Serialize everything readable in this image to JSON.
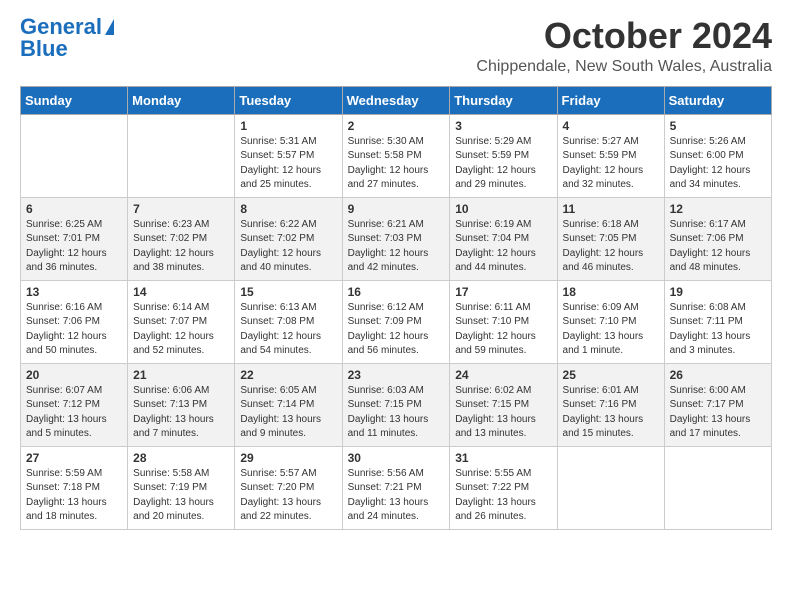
{
  "logo": {
    "general": "General",
    "blue": "Blue"
  },
  "header": {
    "month": "October 2024",
    "location": "Chippendale, New South Wales, Australia"
  },
  "weekdays": [
    "Sunday",
    "Monday",
    "Tuesday",
    "Wednesday",
    "Thursday",
    "Friday",
    "Saturday"
  ],
  "weeks": [
    [
      {
        "day": "",
        "info": ""
      },
      {
        "day": "",
        "info": ""
      },
      {
        "day": "1",
        "info": "Sunrise: 5:31 AM\nSunset: 5:57 PM\nDaylight: 12 hours\nand 25 minutes."
      },
      {
        "day": "2",
        "info": "Sunrise: 5:30 AM\nSunset: 5:58 PM\nDaylight: 12 hours\nand 27 minutes."
      },
      {
        "day": "3",
        "info": "Sunrise: 5:29 AM\nSunset: 5:59 PM\nDaylight: 12 hours\nand 29 minutes."
      },
      {
        "day": "4",
        "info": "Sunrise: 5:27 AM\nSunset: 5:59 PM\nDaylight: 12 hours\nand 32 minutes."
      },
      {
        "day": "5",
        "info": "Sunrise: 5:26 AM\nSunset: 6:00 PM\nDaylight: 12 hours\nand 34 minutes."
      }
    ],
    [
      {
        "day": "6",
        "info": "Sunrise: 6:25 AM\nSunset: 7:01 PM\nDaylight: 12 hours\nand 36 minutes."
      },
      {
        "day": "7",
        "info": "Sunrise: 6:23 AM\nSunset: 7:02 PM\nDaylight: 12 hours\nand 38 minutes."
      },
      {
        "day": "8",
        "info": "Sunrise: 6:22 AM\nSunset: 7:02 PM\nDaylight: 12 hours\nand 40 minutes."
      },
      {
        "day": "9",
        "info": "Sunrise: 6:21 AM\nSunset: 7:03 PM\nDaylight: 12 hours\nand 42 minutes."
      },
      {
        "day": "10",
        "info": "Sunrise: 6:19 AM\nSunset: 7:04 PM\nDaylight: 12 hours\nand 44 minutes."
      },
      {
        "day": "11",
        "info": "Sunrise: 6:18 AM\nSunset: 7:05 PM\nDaylight: 12 hours\nand 46 minutes."
      },
      {
        "day": "12",
        "info": "Sunrise: 6:17 AM\nSunset: 7:06 PM\nDaylight: 12 hours\nand 48 minutes."
      }
    ],
    [
      {
        "day": "13",
        "info": "Sunrise: 6:16 AM\nSunset: 7:06 PM\nDaylight: 12 hours\nand 50 minutes."
      },
      {
        "day": "14",
        "info": "Sunrise: 6:14 AM\nSunset: 7:07 PM\nDaylight: 12 hours\nand 52 minutes."
      },
      {
        "day": "15",
        "info": "Sunrise: 6:13 AM\nSunset: 7:08 PM\nDaylight: 12 hours\nand 54 minutes."
      },
      {
        "day": "16",
        "info": "Sunrise: 6:12 AM\nSunset: 7:09 PM\nDaylight: 12 hours\nand 56 minutes."
      },
      {
        "day": "17",
        "info": "Sunrise: 6:11 AM\nSunset: 7:10 PM\nDaylight: 12 hours\nand 59 minutes."
      },
      {
        "day": "18",
        "info": "Sunrise: 6:09 AM\nSunset: 7:10 PM\nDaylight: 13 hours\nand 1 minute."
      },
      {
        "day": "19",
        "info": "Sunrise: 6:08 AM\nSunset: 7:11 PM\nDaylight: 13 hours\nand 3 minutes."
      }
    ],
    [
      {
        "day": "20",
        "info": "Sunrise: 6:07 AM\nSunset: 7:12 PM\nDaylight: 13 hours\nand 5 minutes."
      },
      {
        "day": "21",
        "info": "Sunrise: 6:06 AM\nSunset: 7:13 PM\nDaylight: 13 hours\nand 7 minutes."
      },
      {
        "day": "22",
        "info": "Sunrise: 6:05 AM\nSunset: 7:14 PM\nDaylight: 13 hours\nand 9 minutes."
      },
      {
        "day": "23",
        "info": "Sunrise: 6:03 AM\nSunset: 7:15 PM\nDaylight: 13 hours\nand 11 minutes."
      },
      {
        "day": "24",
        "info": "Sunrise: 6:02 AM\nSunset: 7:15 PM\nDaylight: 13 hours\nand 13 minutes."
      },
      {
        "day": "25",
        "info": "Sunrise: 6:01 AM\nSunset: 7:16 PM\nDaylight: 13 hours\nand 15 minutes."
      },
      {
        "day": "26",
        "info": "Sunrise: 6:00 AM\nSunset: 7:17 PM\nDaylight: 13 hours\nand 17 minutes."
      }
    ],
    [
      {
        "day": "27",
        "info": "Sunrise: 5:59 AM\nSunset: 7:18 PM\nDaylight: 13 hours\nand 18 minutes."
      },
      {
        "day": "28",
        "info": "Sunrise: 5:58 AM\nSunset: 7:19 PM\nDaylight: 13 hours\nand 20 minutes."
      },
      {
        "day": "29",
        "info": "Sunrise: 5:57 AM\nSunset: 7:20 PM\nDaylight: 13 hours\nand 22 minutes."
      },
      {
        "day": "30",
        "info": "Sunrise: 5:56 AM\nSunset: 7:21 PM\nDaylight: 13 hours\nand 24 minutes."
      },
      {
        "day": "31",
        "info": "Sunrise: 5:55 AM\nSunset: 7:22 PM\nDaylight: 13 hours\nand 26 minutes."
      },
      {
        "day": "",
        "info": ""
      },
      {
        "day": "",
        "info": ""
      }
    ]
  ]
}
